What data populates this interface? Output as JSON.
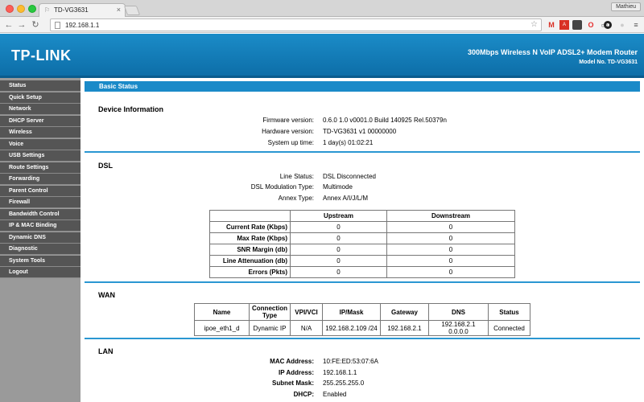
{
  "browser": {
    "tab_title": "TD-VG3631",
    "tab_close": "×",
    "profile": "Mathieu",
    "url": "192.168.1.1",
    "icons": [
      "back-icon",
      "forward-icon",
      "reload-icon",
      "star-icon"
    ],
    "ext_labels": [
      "M",
      "A",
      "",
      "O",
      "",
      "",
      "",
      "≡"
    ]
  },
  "header": {
    "logo": "TP-LINK",
    "product": "300Mbps Wireless N VoIP ADSL2+ Modem Router",
    "model": "Model No. TD-VG3631",
    "bg_color": "#1783c0"
  },
  "sidebar": {
    "items": [
      "Status",
      "Quick Setup",
      "Network",
      "DHCP Server",
      "Wireless",
      "Voice",
      "USB Settings",
      "Route Settings",
      "Forwarding",
      "Parent Control",
      "Firewall",
      "Bandwidth Control",
      "IP & MAC Binding",
      "Dynamic DNS",
      "Diagnostic",
      "System Tools",
      "Logout"
    ]
  },
  "main": {
    "title": "Basic Status",
    "device": {
      "title": "Device Information",
      "firmware_label": "Firmware version:",
      "firmware": "0.6.0 1.0 v0001.0 Build 140925 Rel.50379n",
      "hardware_label": "Hardware version:",
      "hardware": "TD-VG3631 v1 00000000",
      "uptime_label": "System up time:",
      "uptime": "1 day(s) 01:02:21"
    },
    "dsl": {
      "title": "DSL",
      "line_status_label": "Line Status:",
      "line_status": "DSL Disconnected",
      "modulation_label": "DSL Modulation Type:",
      "modulation": "Multimode",
      "annex_label": "Annex Type:",
      "annex": "Annex A/I/J/L/M",
      "col_upstream": "Upstream",
      "col_downstream": "Downstream",
      "rows": [
        {
          "label": "Current Rate (Kbps)",
          "up": "0",
          "down": "0"
        },
        {
          "label": "Max Rate (Kbps)",
          "up": "0",
          "down": "0"
        },
        {
          "label": "SNR Margin (db)",
          "up": "0",
          "down": "0"
        },
        {
          "label": "Line Attenuation (db)",
          "up": "0",
          "down": "0"
        },
        {
          "label": "Errors (Pkts)",
          "up": "0",
          "down": "0"
        }
      ]
    },
    "wan": {
      "title": "WAN",
      "headers": [
        "Name",
        "Connection Type",
        "VPI/VCI",
        "IP/Mask",
        "Gateway",
        "DNS",
        "Status"
      ],
      "row": [
        "ipoe_eth1_d",
        "Dynamic IP",
        "N/A",
        "192.168.2.109 /24",
        "192.168.2.1",
        "192.168.2.1 0.0.0.0",
        "Connected"
      ]
    },
    "lan": {
      "title": "LAN",
      "mac_label": "MAC Address:",
      "mac": "10:FE:ED:53:07:6A",
      "ip_label": "IP Address:",
      "ip": "192.168.1.1",
      "mask_label": "Subnet Mask:",
      "mask": "255.255.255.0",
      "dhcp_label": "DHCP:",
      "dhcp": "Enabled"
    }
  }
}
